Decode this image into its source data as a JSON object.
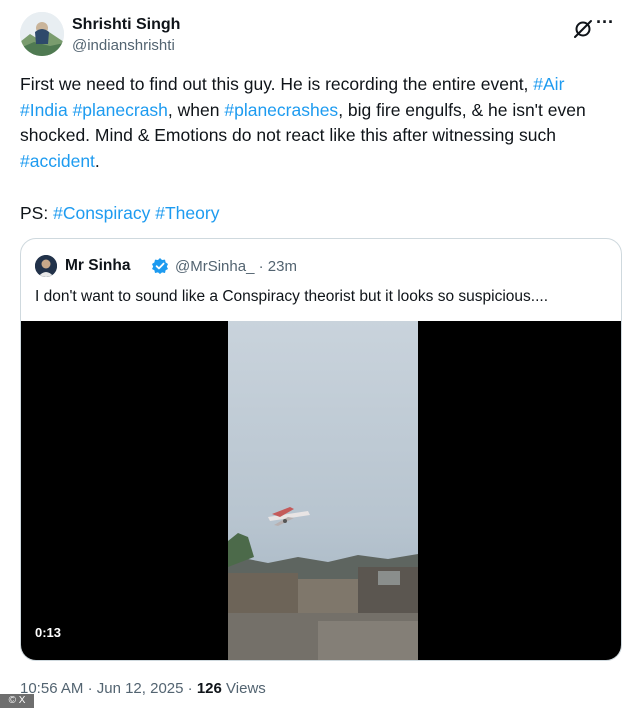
{
  "author": {
    "name": "Shrishti Singh",
    "handle": "@indianshrishti"
  },
  "icons": {
    "grok": "grok-icon",
    "more": "more-icon",
    "verified": "verified-badge-icon"
  },
  "tweet": {
    "text_segments": [
      {
        "text": "First we need to find out this guy. He is recording the entire event, ",
        "type": "text"
      },
      {
        "text": "#Air",
        "type": "hashtag"
      },
      {
        "text": " ",
        "type": "text"
      },
      {
        "text": "#India",
        "type": "hashtag"
      },
      {
        "text": " ",
        "type": "text"
      },
      {
        "text": "#planecrash",
        "type": "hashtag"
      },
      {
        "text": ", when ",
        "type": "text"
      },
      {
        "text": "#planecrashes",
        "type": "hashtag"
      },
      {
        "text": ", big fire engulfs, & he isn't even shocked. Mind & Emotions do not react like this after witnessing such ",
        "type": "text"
      },
      {
        "text": "#accident",
        "type": "hashtag"
      },
      {
        "text": ".",
        "type": "text"
      }
    ],
    "ps_label": "PS:",
    "ps_tags": [
      "#Conspiracy",
      "#Theory"
    ]
  },
  "quote": {
    "name": "Mr Sinha",
    "handle": "@MrSinha_",
    "separator": "·",
    "time": "23m",
    "text": "I don't want to sound like a Conspiracy theorist but it looks so suspicious....",
    "video_duration": "0:13"
  },
  "meta": {
    "time": "10:56 AM",
    "dot1": "·",
    "date": "Jun 12, 2025",
    "dot2": "·",
    "views_count": "126",
    "views_label": "Views"
  },
  "credit": "© X",
  "colors": {
    "link": "#1d9bf0",
    "secondary": "#536471",
    "border": "#cfd9de"
  }
}
